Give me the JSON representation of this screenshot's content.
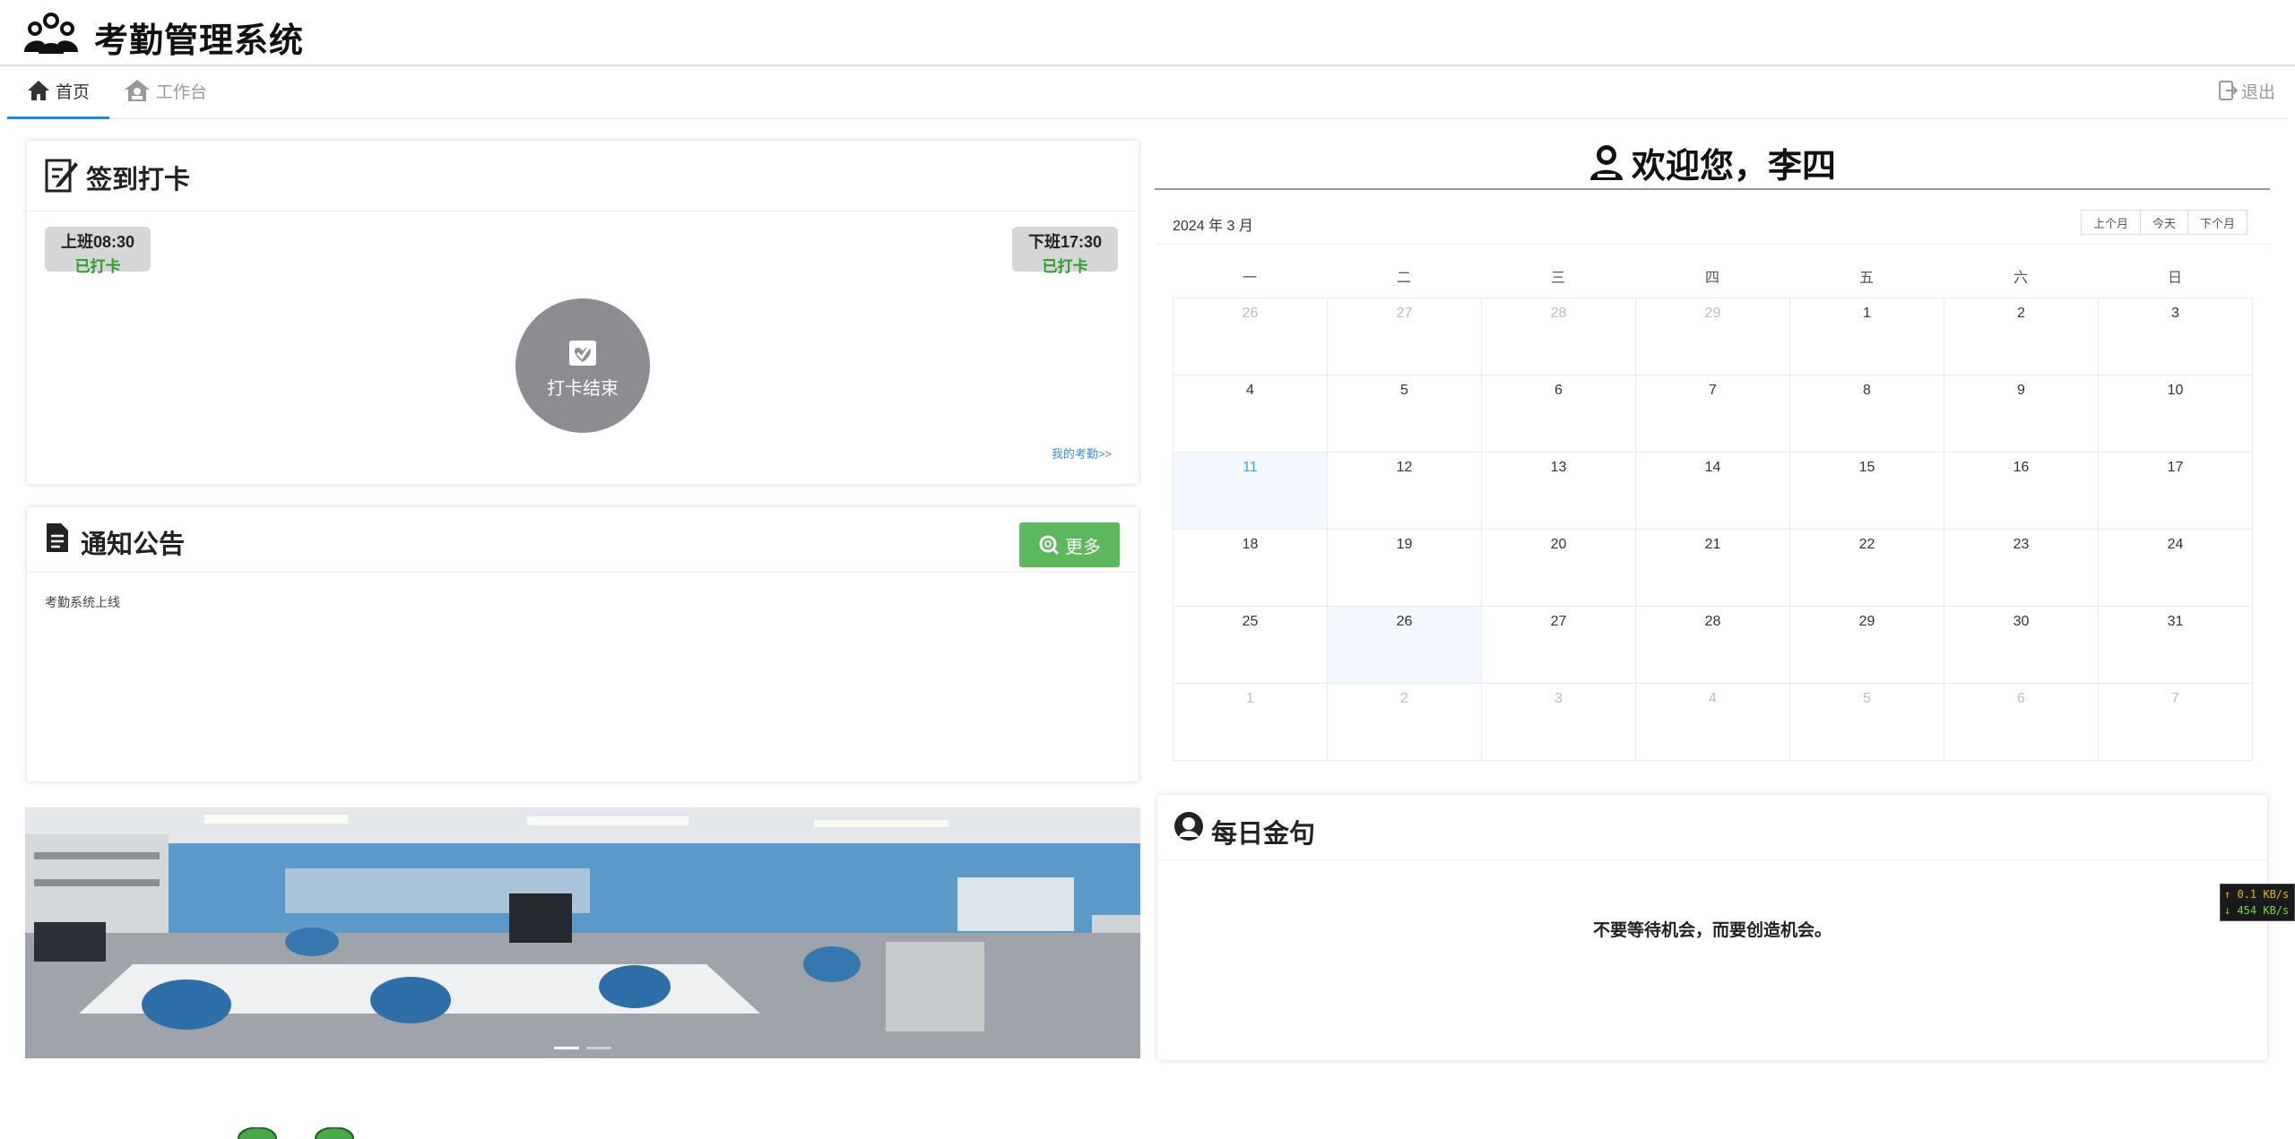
{
  "app": {
    "title": "考勤管理系统"
  },
  "nav": {
    "tabs": [
      {
        "label": "首页",
        "icon": "home-icon",
        "active": true
      },
      {
        "label": "工作台",
        "icon": "workbench-icon",
        "active": false
      }
    ],
    "logout_label": "退出"
  },
  "checkin": {
    "title": "签到打卡",
    "start": {
      "label": "上班08:30",
      "status": "已打卡"
    },
    "end": {
      "label": "下班17:30",
      "status": "已打卡"
    },
    "punch_label": "打卡结束",
    "my_attendance_link": "我的考勤>>"
  },
  "notice": {
    "title": "通知公告",
    "more_label": "更多",
    "items": [
      "考勤系统上线"
    ]
  },
  "banner": {
    "slides": 2,
    "active_slide": 0
  },
  "welcome": {
    "text": "欢迎您，李四"
  },
  "calendar": {
    "month_label": "2024 年 3 月",
    "buttons": [
      "上个月",
      "今天",
      "下个月"
    ],
    "weekdays": [
      "一",
      "二",
      "三",
      "四",
      "五",
      "六",
      "日"
    ],
    "weeks": [
      [
        {
          "d": "26",
          "o": true
        },
        {
          "d": "27",
          "o": true
        },
        {
          "d": "28",
          "o": true
        },
        {
          "d": "29",
          "o": true
        },
        {
          "d": "1"
        },
        {
          "d": "2"
        },
        {
          "d": "3"
        }
      ],
      [
        {
          "d": "4"
        },
        {
          "d": "5"
        },
        {
          "d": "6"
        },
        {
          "d": "7"
        },
        {
          "d": "8"
        },
        {
          "d": "9"
        },
        {
          "d": "10"
        }
      ],
      [
        {
          "d": "11",
          "today": true
        },
        {
          "d": "12"
        },
        {
          "d": "13"
        },
        {
          "d": "14"
        },
        {
          "d": "15"
        },
        {
          "d": "16"
        },
        {
          "d": "17"
        }
      ],
      [
        {
          "d": "18"
        },
        {
          "d": "19"
        },
        {
          "d": "20"
        },
        {
          "d": "21"
        },
        {
          "d": "22"
        },
        {
          "d": "23"
        },
        {
          "d": "24"
        }
      ],
      [
        {
          "d": "25"
        },
        {
          "d": "26",
          "selected": true
        },
        {
          "d": "27"
        },
        {
          "d": "28"
        },
        {
          "d": "29"
        },
        {
          "d": "30"
        },
        {
          "d": "31"
        }
      ],
      [
        {
          "d": "1",
          "o": true
        },
        {
          "d": "2",
          "o": true
        },
        {
          "d": "3",
          "o": true
        },
        {
          "d": "4",
          "o": true
        },
        {
          "d": "5",
          "o": true
        },
        {
          "d": "6",
          "o": true
        },
        {
          "d": "7",
          "o": true
        }
      ]
    ]
  },
  "quote": {
    "title": "每日金句",
    "text": "不要等待机会，而要创造机会。"
  },
  "network": {
    "up": "↑ 0.1 KB/s",
    "down": "↓ 454 KB/s"
  },
  "colors": {
    "accent": "#1e88e5",
    "success": "#5cb85c",
    "done_text": "#2e9b2e",
    "punch_circle": "#8c8c93"
  }
}
